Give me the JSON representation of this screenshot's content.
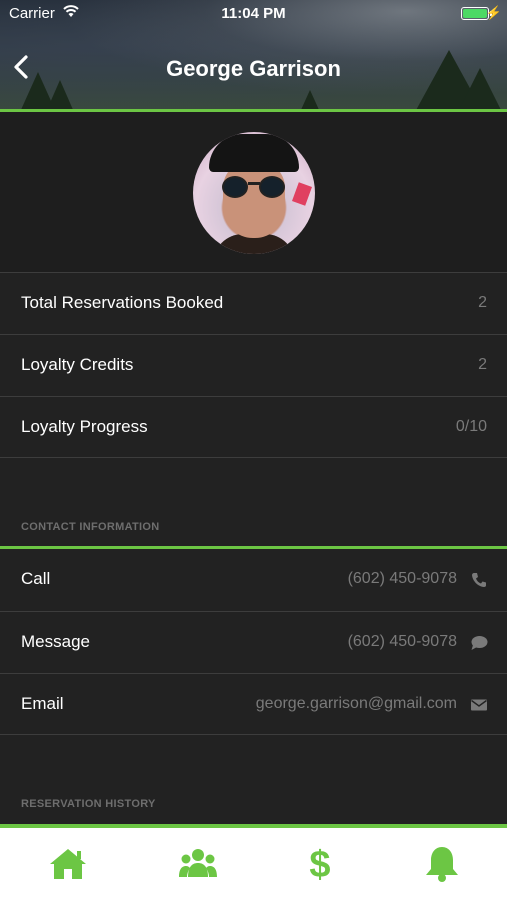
{
  "status_bar": {
    "carrier": "Carrier",
    "time": "11:04 PM"
  },
  "header": {
    "title": "George Garrison"
  },
  "stats": [
    {
      "label": "Total Reservations Booked",
      "value": "2"
    },
    {
      "label": "Loyalty Credits",
      "value": "2"
    },
    {
      "label": "Loyalty Progress",
      "value": "0/10"
    }
  ],
  "contact": {
    "section_title": "CONTACT INFORMATION",
    "items": [
      {
        "label": "Call",
        "value": "(602) 450-9078",
        "icon": "phone-icon"
      },
      {
        "label": "Message",
        "value": "(602) 450-9078",
        "icon": "chat-bubble-icon"
      },
      {
        "label": "Email",
        "value": "george.garrison@gmail.com",
        "icon": "envelope-icon"
      }
    ]
  },
  "reservation_history": {
    "section_title": "RESERVATION HISTORY"
  },
  "tab_bar": {
    "tabs": [
      "home-icon",
      "users-icon",
      "dollar-icon",
      "bell-icon"
    ]
  },
  "colors": {
    "accent": "#6cc644",
    "background": "#222222",
    "secondary_text": "#7a7a7a",
    "section_label": "#6e6e6e"
  }
}
